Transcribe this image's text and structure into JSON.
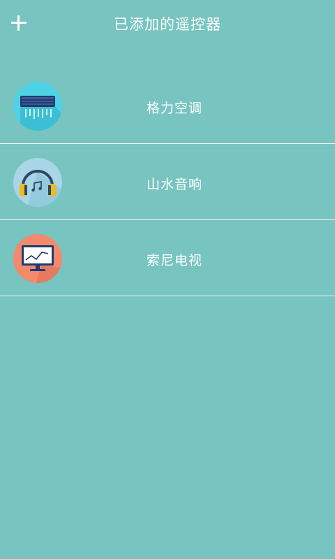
{
  "header": {
    "title": "已添加的遥控器",
    "add_icon": "plus-icon"
  },
  "remotes": [
    {
      "label": "格力空调",
      "icon": "air-conditioner-icon",
      "color": "#4fd2e6"
    },
    {
      "label": "山水音响",
      "icon": "headphones-icon",
      "color": "#a8d6e6"
    },
    {
      "label": "索尼电视",
      "icon": "tv-monitor-icon",
      "color": "#f38a6e"
    }
  ]
}
